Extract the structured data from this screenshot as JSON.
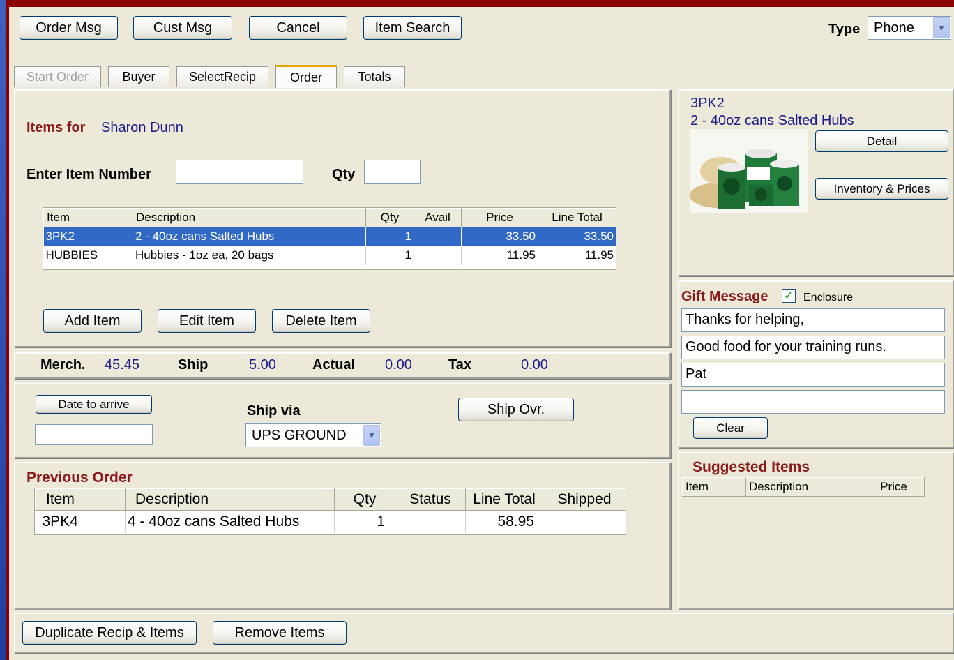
{
  "toolbar": {
    "order_msg": "Order Msg",
    "cust_msg": "Cust Msg",
    "cancel": "Cancel",
    "item_search": "Item Search",
    "type_label": "Type",
    "type_value": "Phone"
  },
  "tabs": [
    {
      "label": "Start Order",
      "state": "disabled"
    },
    {
      "label": "Buyer",
      "state": "normal"
    },
    {
      "label": "SelectRecip",
      "state": "normal"
    },
    {
      "label": "Order",
      "state": "active"
    },
    {
      "label": "Totals",
      "state": "normal"
    }
  ],
  "items": {
    "items_for_label": "Items for",
    "customer_name": "Sharon Dunn",
    "enter_item_label": "Enter Item Number",
    "qty_label": "Qty",
    "item_number_value": "",
    "qty_value": "",
    "columns": [
      "Item",
      "Description",
      "Qty",
      "Avail",
      "Price",
      "Line Total"
    ],
    "rows": [
      {
        "item": "3PK2",
        "description": "2 - 40oz cans Salted Hubs",
        "qty": "1",
        "avail": "",
        "price": "33.50",
        "line_total": "33.50",
        "selected": true
      },
      {
        "item": "HUBBIES",
        "description": "Hubbies - 1oz ea, 20 bags",
        "qty": "1",
        "avail": "",
        "price": "11.95",
        "line_total": "11.95",
        "selected": false
      }
    ],
    "add_item": "Add Item",
    "edit_item": "Edit Item",
    "delete_item": "Delete Item"
  },
  "totals": {
    "merch_label": "Merch.",
    "merch_value": "45.45",
    "ship_label": "Ship",
    "ship_value": "5.00",
    "actual_label": "Actual",
    "actual_value": "0.00",
    "tax_label": "Tax",
    "tax_value": "0.00"
  },
  "shipping": {
    "date_button": "Date to arrive",
    "date_value": "",
    "ship_via_label": "Ship via",
    "ship_via_value": "UPS GROUND",
    "ship_ovr": "Ship Ovr."
  },
  "previous_order": {
    "title": "Previous Order",
    "columns": [
      "Item",
      "Description",
      "Qty",
      "Status",
      "Line Total",
      "Shipped"
    ],
    "rows": [
      {
        "item": "3PK4",
        "description": "4 - 40oz cans Salted Hubs",
        "qty": "1",
        "status": "",
        "line_total": "58.95",
        "shipped": ""
      }
    ]
  },
  "product": {
    "code": "3PK2",
    "name": "2 - 40oz cans Salted Hubs",
    "detail": "Detail",
    "inventory": "Inventory & Prices"
  },
  "gift": {
    "title": "Gift Message",
    "enclosure_label": "Enclosure",
    "enclosure_checked": true,
    "lines": [
      "Thanks for helping,",
      "Good food for your training runs.",
      "Pat",
      ""
    ],
    "clear": "Clear"
  },
  "suggested": {
    "title": "Suggested Items",
    "columns": [
      "Item",
      "Description",
      "Price"
    ]
  },
  "footer": {
    "duplicate": "Duplicate Recip & Items",
    "remove": "Remove Items"
  },
  "colors": {
    "frame": "#8b0000",
    "background": "#ece9d8",
    "accent_label": "#8b1a1a",
    "link_text": "#1a1a8b",
    "selection": "#3169c6",
    "active_tab": "#e6a800"
  }
}
